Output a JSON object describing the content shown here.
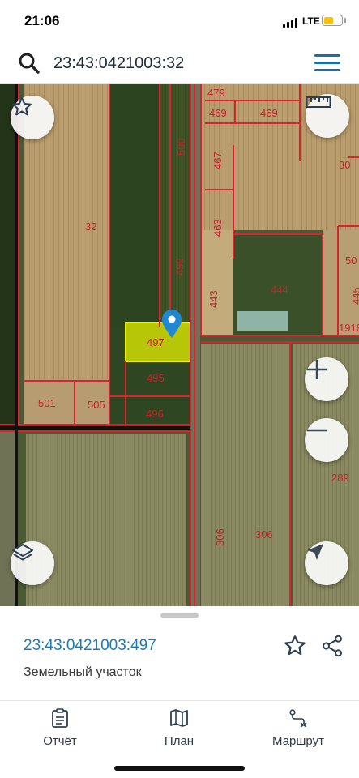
{
  "status_bar": {
    "time": "21:06",
    "network": "LTE",
    "battery_level": 0.55,
    "battery_color": "#f4c20d"
  },
  "search": {
    "query": "23:43:0421003:32",
    "search_icon": "search-icon",
    "menu_icon": "hamburger-menu-icon"
  },
  "map": {
    "selected_parcel": "497",
    "parcel_labels": [
      "479",
      "469",
      "469",
      "500",
      "467",
      "30",
      "32",
      "463",
      "499",
      "50",
      "443",
      "444",
      "445",
      "1918",
      "497",
      "495",
      "501",
      "505",
      "496",
      "289",
      "306",
      "306"
    ],
    "controls": {
      "favorite_icon": "star-icon",
      "ruler_icon": "ruler-icon",
      "zoom_in_icon": "plus-icon",
      "zoom_out_icon": "minus-icon",
      "layers_icon": "layers-icon",
      "locate_icon": "navigation-arrow-icon"
    },
    "colors": {
      "boundary": "#d8242e",
      "selected_fill": "#e7f200",
      "marker": "#1e88d4"
    }
  },
  "sheet": {
    "cadastral_number": "23:43:0421003:497",
    "parcel_type": "Земельный участок",
    "favorite_icon": "star-outline-icon",
    "share_icon": "share-icon"
  },
  "tabs": [
    {
      "label": "Отчёт",
      "icon": "report-clipboard-icon"
    },
    {
      "label": "План",
      "icon": "map-book-icon"
    },
    {
      "label": "Маршрут",
      "icon": "route-icon"
    }
  ]
}
